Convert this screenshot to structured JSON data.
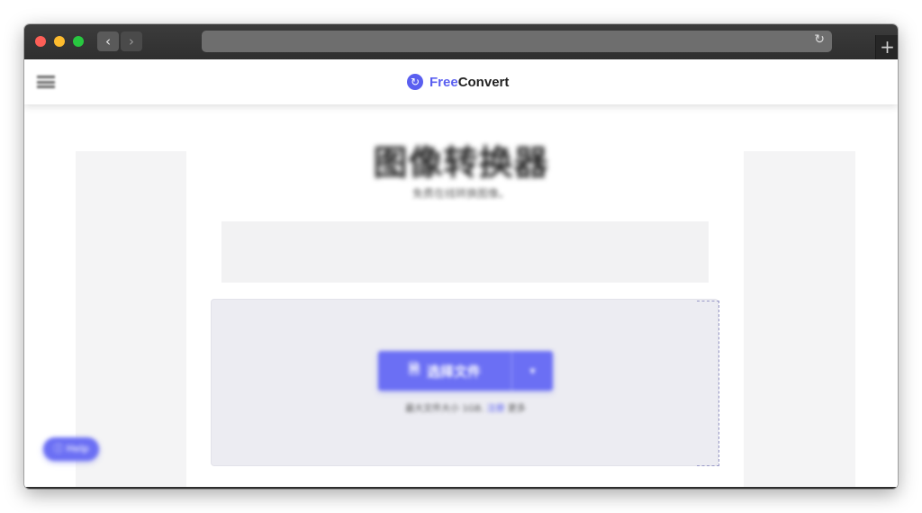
{
  "browser": {
    "back_glyph": "‹",
    "forward_glyph": "›",
    "reload_glyph": "↻",
    "newtab_glyph": "+",
    "url": ""
  },
  "site": {
    "logo_free": "Free",
    "logo_convert": "Convert",
    "logo_icon_glyph": "↻",
    "brand_color": "#5a5ff0"
  },
  "page": {
    "title": "图像转换器",
    "subtitle": "免费在线转换图像。"
  },
  "upload": {
    "choose_label": "选择文件",
    "file_icon_glyph": "🗎",
    "caret_glyph": "▾",
    "hint_before": "最大文件大小 1GB.",
    "hint_link": "注册",
    "hint_after": "更多"
  },
  "help": {
    "label": "ⓘ Help"
  }
}
